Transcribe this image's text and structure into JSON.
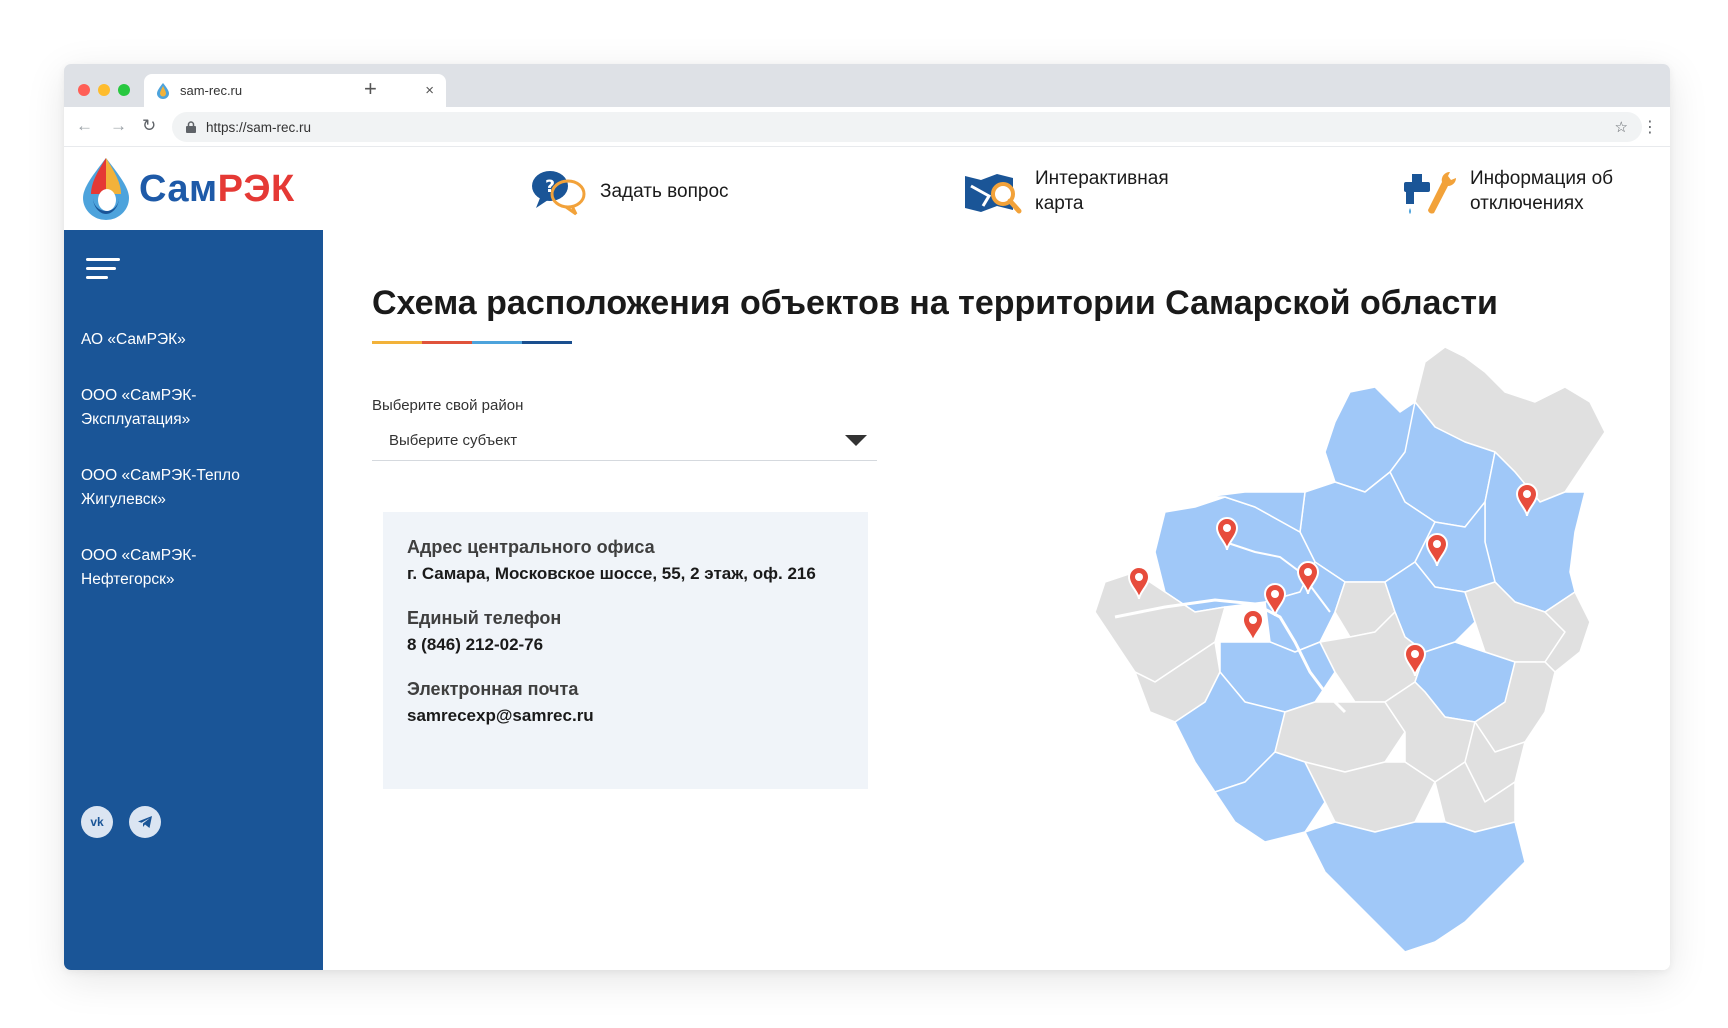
{
  "browser": {
    "tab_title": "sam-rec.ru",
    "url": "https://sam-rec.ru",
    "new_tab": "+",
    "close": "×"
  },
  "logo": {
    "part1": "Сам",
    "part2": "РЭК"
  },
  "sidebar": {
    "items": [
      {
        "label": "АО «СамРЭК»"
      },
      {
        "label": "ООО «СамРЭК-Эксплуатация»"
      },
      {
        "label": "ООО «СамРЭК-Тепло Жигулевск»"
      },
      {
        "label": "ООО «СамРЭК-Нефтегорск»"
      }
    ],
    "socials": [
      "vk-icon",
      "telegram-icon"
    ]
  },
  "top_links": [
    {
      "label": "Задать вопрос",
      "icon": "question-chat-icon"
    },
    {
      "label": "Интерактивная карта",
      "icon": "map-search-icon"
    },
    {
      "label": "Информация об отключениях",
      "icon": "faucet-wrench-icon"
    }
  ],
  "main": {
    "title": "Схема расположения объектов на территории Самарской области",
    "district_label": "Выберите свой район",
    "district_select": "Выберите субъект"
  },
  "contacts": {
    "address_label": "Адрес центрального офиса",
    "address_value": "г. Самара, Московское шоссе, 55, 2 этаж, оф. 216",
    "phone_label": "Единый телефон",
    "phone_value": "8 (846) 212-02-76",
    "email_label": "Электронная почта",
    "email_value": "samrecexp@samrec.ru"
  },
  "colors": {
    "brand_blue": "#1a5597",
    "brand_red": "#e53935",
    "map_active": "#a0c8f8",
    "map_inactive": "#e0e0e0",
    "marker": "#e74c3c",
    "underline": [
      "#f2b23a",
      "#e0533b",
      "#4da3dc",
      "#1a4f8f"
    ]
  },
  "map": {
    "markers": 8
  }
}
